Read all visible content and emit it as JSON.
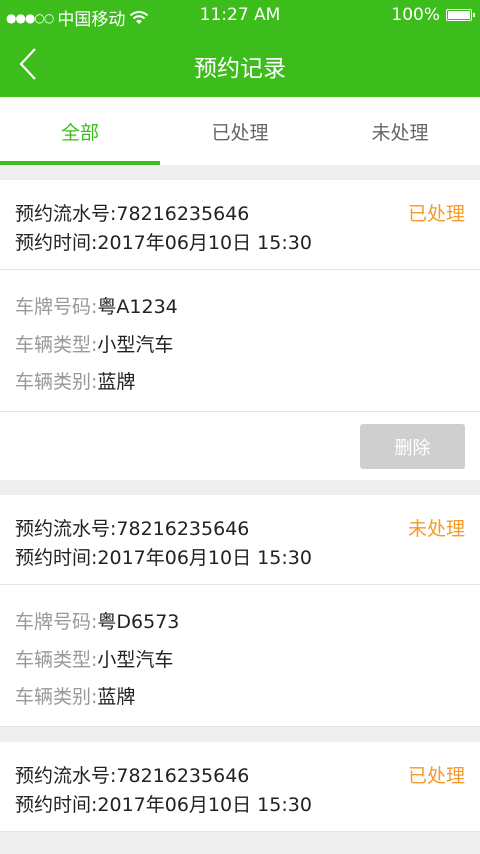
{
  "status_bar": {
    "signal": "●●●○○",
    "carrier": "中国移动",
    "time": "11:27 AM",
    "battery": "100%"
  },
  "header": {
    "title": "预约记录"
  },
  "tabs": [
    {
      "label": "全部"
    },
    {
      "label": "已处理"
    },
    {
      "label": "未处理"
    }
  ],
  "records": [
    {
      "serial_label": "预约流水号:",
      "serial": "78216235646",
      "time_label": "预约时间:",
      "time": "2017年06月10日 15:30",
      "status": "已处理",
      "plate_label": "车牌号码:",
      "plate": "粤A1234",
      "vehicle_type_label": "车辆类型:",
      "vehicle_type": "小型汽车",
      "vehicle_class_label": "车辆类别:",
      "vehicle_class": "蓝牌",
      "delete_label": "删除"
    },
    {
      "serial_label": "预约流水号:",
      "serial": "78216235646",
      "time_label": "预约时间:",
      "time": "2017年06月10日 15:30",
      "status": "未处理",
      "plate_label": "车牌号码:",
      "plate": "粤D6573",
      "vehicle_type_label": "车辆类型:",
      "vehicle_type": "小型汽车",
      "vehicle_class_label": "车辆类别:",
      "vehicle_class": "蓝牌"
    },
    {
      "serial_label": "预约流水号:",
      "serial": "78216235646",
      "time_label": "预约时间:",
      "time": "2017年06月10日 15:30",
      "status": "已处理"
    }
  ],
  "colors": {
    "primary": "#3dbd1c",
    "status_orange": "#f39a2b"
  }
}
